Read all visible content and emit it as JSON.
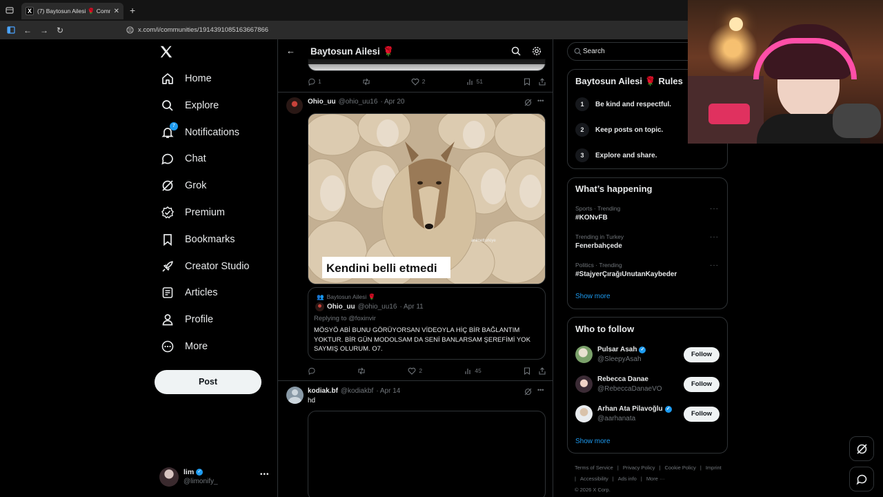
{
  "browser": {
    "tab_title": "(7) Baytosun Ailesi 🌹 Communi",
    "url": "x.com/i/communities/1914391085163667866"
  },
  "nav": {
    "items": [
      {
        "label": "Home",
        "icon": "home-icon"
      },
      {
        "label": "Explore",
        "icon": "search-icon"
      },
      {
        "label": "Notifications",
        "icon": "bell-icon",
        "badge": "7"
      },
      {
        "label": "Chat",
        "icon": "chat-icon"
      },
      {
        "label": "Grok",
        "icon": "grok-icon"
      },
      {
        "label": "Premium",
        "icon": "premium-icon"
      },
      {
        "label": "Bookmarks",
        "icon": "bookmark-icon"
      },
      {
        "label": "Creator Studio",
        "icon": "rocket-icon"
      },
      {
        "label": "Articles",
        "icon": "article-icon"
      },
      {
        "label": "Profile",
        "icon": "person-icon"
      },
      {
        "label": "More",
        "icon": "more-circle-icon"
      }
    ],
    "post_label": "Post",
    "account": {
      "name": "lim",
      "handle": "@limonify_"
    }
  },
  "header": {
    "title": "Baytosun Ailesi 🌹"
  },
  "top_post_actions": {
    "replies": "1",
    "likes": "2",
    "views": "51"
  },
  "post1": {
    "name": "Ohio_uu",
    "handle": "@ohio_uu16",
    "date": "· Apr 20",
    "image_caption": "Kendini belli etmedi",
    "watermark": "animetturkiye",
    "quote": {
      "community": "Baytosun Ailesi 🌹",
      "name": "Ohio_uu",
      "handle": "@ohio_uu16",
      "date": "· Apr 11",
      "replying": "Replying to @foxinvir",
      "text": "MÖSYÖ ABİ BUNU GÖRÜYORSAN VİDEOYLA HİÇ BİR BAĞLANTIM YOKTUR. BİR GÜN MODOLSAM DA SENİ BANLARSAM ŞEREFİMİ YOK SAYMIŞ OLURUM. O7."
    },
    "likes": "2",
    "views": "45"
  },
  "post2": {
    "name": "kodiak.bf",
    "handle": "@kodiakbf",
    "date": "· Apr 14",
    "text": "hd"
  },
  "search": {
    "placeholder": "Search"
  },
  "rules": {
    "title": "Baytosun Ailesi 🌹 Rules",
    "items": [
      {
        "num": "1",
        "text": "Be kind and respectful."
      },
      {
        "num": "2",
        "text": "Keep posts on topic."
      },
      {
        "num": "3",
        "text": "Explore and share."
      }
    ]
  },
  "happening": {
    "title": "What’s happening",
    "trends": [
      {
        "category": "Sports · Trending",
        "name": "#KONvFB"
      },
      {
        "category": "Trending in Turkey",
        "name": "Fenerbahçede"
      },
      {
        "category": "Politics · Trending",
        "name": "#StajyerÇırağıUnutanKaybeder"
      }
    ],
    "show_more": "Show more"
  },
  "who_to_follow": {
    "title": "Who to follow",
    "users": [
      {
        "name": "Pulsar Asah",
        "handle": "@SleepyAsah",
        "verified": true
      },
      {
        "name": "Rebecca Danae",
        "handle": "@RebeccaDanaeVO",
        "verified": false
      },
      {
        "name": "Arhan Ata Pilavoğlu",
        "handle": "@aarhanata",
        "verified": true
      }
    ],
    "follow_label": "Follow",
    "show_more": "Show more"
  },
  "footer": {
    "links": [
      "Terms of Service",
      "|",
      "Privacy Policy",
      "|",
      "Cookie Policy",
      "|",
      "Imprint",
      "|",
      "Accessibility",
      "|",
      "Ads info",
      "|",
      "More ···"
    ],
    "copyright": "© 2026 X Corp."
  },
  "colors": {
    "accent": "#1d9bf0",
    "background": "#000000",
    "border": "#2f3336",
    "muted": "#71767b"
  }
}
